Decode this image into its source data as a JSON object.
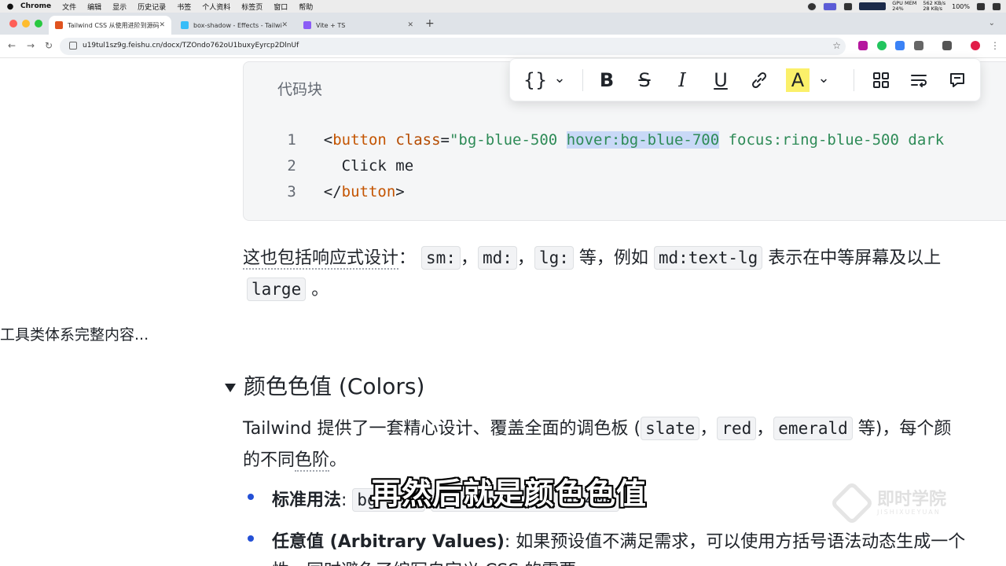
{
  "menubar": {
    "apple": "",
    "items": [
      "Chrome",
      "文件",
      "编辑",
      "显示",
      "历史记录",
      "书签",
      "个人资料",
      "标签页",
      "窗口",
      "帮助"
    ],
    "gpu_label": "GPU",
    "mem_label": "MEM",
    "mem_value": "24%",
    "net_up": "562 KB/s",
    "net_down": "28 KB/s",
    "battery": "100%",
    "time": ""
  },
  "tabs": [
    {
      "title": "Tailwind CSS 从使用进阶到源码",
      "active": true,
      "favicon_color": "#e0531f"
    },
    {
      "title": "box-shadow - Effects - Tailwi",
      "active": false,
      "favicon_color": "#38bdf8"
    },
    {
      "title": "Vite + TS",
      "active": false,
      "favicon_color": "#8a5cf6"
    }
  ],
  "address_bar": {
    "url": "u19tul1sz9g.feishu.cn/docx/TZOndo762oU1buxyEyrcp2DlnUf"
  },
  "code_block": {
    "label": "代码块",
    "lines": [
      {
        "n": "1",
        "p1": "<",
        "tag": "button",
        "sp": " ",
        "attr": "class",
        "eq": "=",
        "s1": "\"bg-blue-500 ",
        "s_sel": "hover:bg-blue-700",
        "s2": " focus:ring-blue-500 dark"
      },
      {
        "n": "2",
        "text": "  Click me"
      },
      {
        "n": "3",
        "p1": "</",
        "tag": "button",
        "p2": ">"
      }
    ]
  },
  "toolbar": {
    "code_icon": "{}",
    "chevron": "⌄",
    "bold": "B",
    "strike": "S",
    "italic": "I",
    "underline": "U",
    "link_icon": "link-icon",
    "highlight": "A",
    "highlight_color": "#fbf06a"
  },
  "paragraph1": {
    "lead": "这也包括响应式设计",
    "colon": "：",
    "code1": "sm:",
    "comma": "，",
    "code2": "md:",
    "code3": "lg:",
    "mid": " 等，例如 ",
    "code4": "md:text-lg",
    "tail": " 表示在中等屏幕及以上",
    "code5": "large",
    "end": "。"
  },
  "sidebar": {
    "text": "工具类体系完整内容..."
  },
  "section": {
    "heading": "颜色色值 (Colors)"
  },
  "paragraph2": {
    "lead": "Tailwind 提供了一套精心设计、覆盖全面的调色板 (",
    "code1": "slate",
    "comma": "，",
    "code2": "red",
    "code3": "emerald",
    "tail": " 等)，每个颜",
    "line2_a": "的不同",
    "line2_b": "色阶",
    "line2_c": "。"
  },
  "bullets": [
    {
      "label": "标准用法",
      "colon": ": ",
      "code_a": "bg",
      "code_b": "d-400"
    },
    {
      "label": "任意值 (Arbitrary Values)",
      "rest": ": 如果预设值不满足需求，可以使用方括号语法动态生成一个"
    }
  ],
  "footer_partial": "性，同时避免了编写自定义 CSS 的需要。",
  "subtitle": "再然后就是颜色色值",
  "watermark": {
    "title": "即时学院",
    "sub": "JISHIXUEYUAN"
  }
}
